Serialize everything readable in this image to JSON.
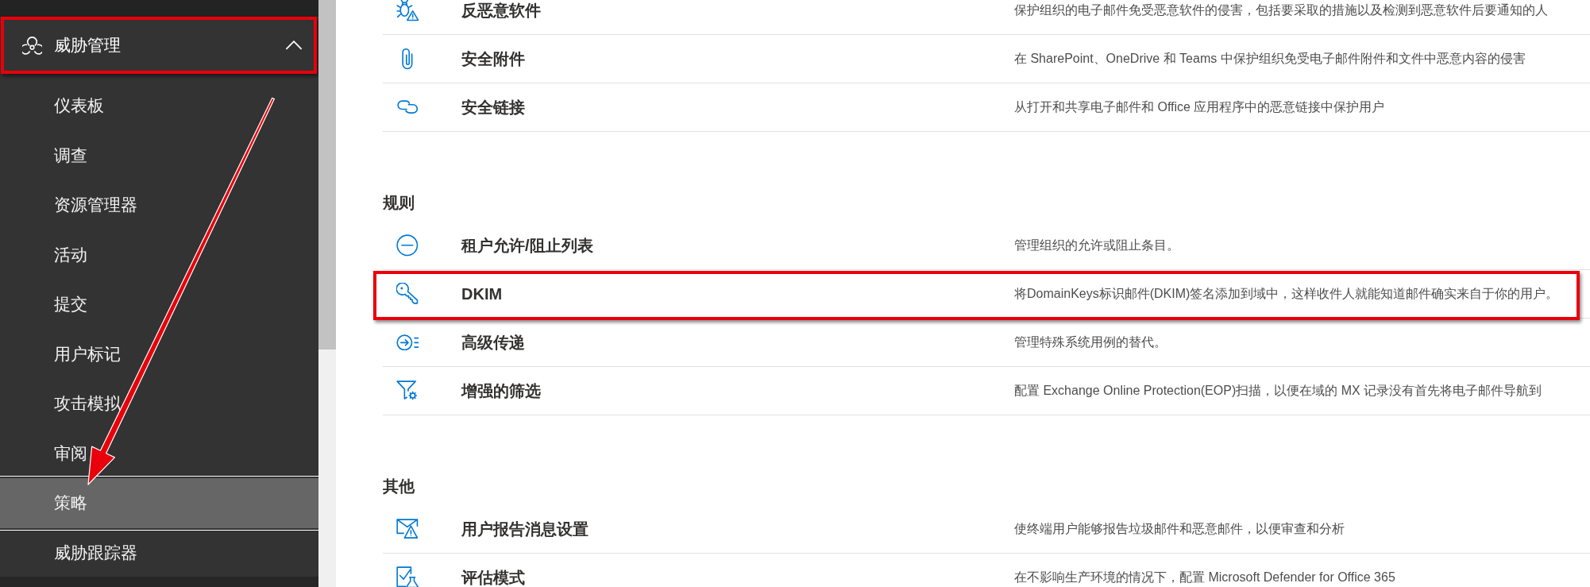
{
  "sidebar": {
    "group": {
      "label": "威胁管理",
      "expanded": true,
      "highlighted": true
    },
    "items": [
      {
        "label": "仪表板",
        "selected": false
      },
      {
        "label": "调查",
        "selected": false
      },
      {
        "label": "资源管理器",
        "selected": false
      },
      {
        "label": "活动",
        "selected": false
      },
      {
        "label": "提交",
        "selected": false
      },
      {
        "label": "用户标记",
        "selected": false
      },
      {
        "label": "攻击模拟",
        "selected": false
      },
      {
        "label": "审阅",
        "selected": false
      },
      {
        "label": "策略",
        "selected": true
      },
      {
        "label": "威胁跟踪器",
        "selected": false
      }
    ]
  },
  "sections": [
    {
      "rows": [
        {
          "name": "反恶意软件",
          "description": "保护组织的电子邮件免受恶意软件的侵害，包括要采取的措施以及检测到恶意软件后要通知的人",
          "highlighted": false
        },
        {
          "name": "安全附件",
          "description": "在 SharePoint、OneDrive 和 Teams 中保护组织免受电子邮件附件和文件中恶意内容的侵害",
          "highlighted": false
        },
        {
          "name": "安全链接",
          "description": "从打开和共享电子邮件和 Office 应用程序中的恶意链接中保护用户",
          "highlighted": false
        }
      ]
    },
    {
      "heading": "规则",
      "rows": [
        {
          "name": "租户允许/阻止列表",
          "description": "管理组织的允许或阻止条目。",
          "highlighted": false
        },
        {
          "name": "DKIM",
          "description": "将DomainKeys标识邮件(DKIM)签名添加到域中，这样收件人就能知道邮件确实来自于你的用户。",
          "highlighted": true
        },
        {
          "name": "高级传递",
          "description": "管理特殊系统用例的替代。",
          "highlighted": false
        },
        {
          "name": "增强的筛选",
          "description": "配置 Exchange Online Protection(EOP)扫描，以便在域的 MX 记录没有首先将电子邮件导航到",
          "highlighted": false
        }
      ]
    },
    {
      "heading": "其他",
      "rows": [
        {
          "name": "用户报告消息设置",
          "description": "使终端用户能够报告垃圾邮件和恶意邮件，以便审查和分析",
          "highlighted": false
        },
        {
          "name": "评估模式",
          "description": "在不影响生产环境的情况下，配置 Microsoft Defender for Office 365",
          "highlighted": false
        }
      ]
    }
  ]
}
